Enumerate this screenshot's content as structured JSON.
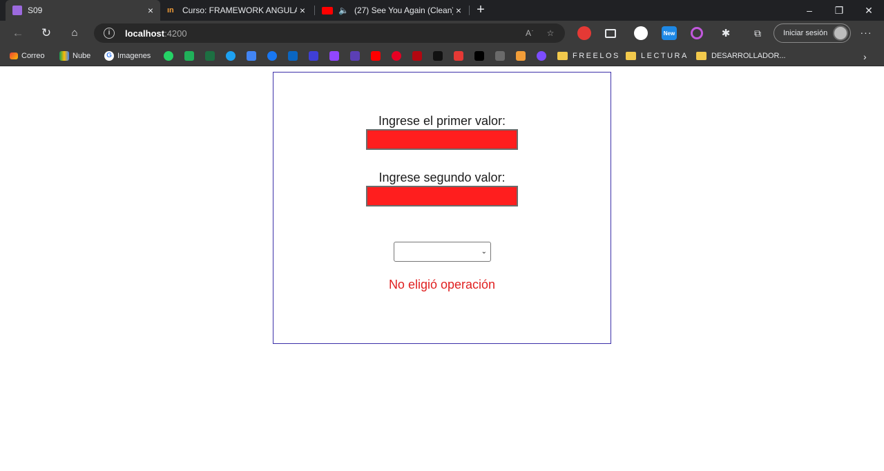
{
  "browser": {
    "tabs": [
      {
        "title": "S09",
        "icon": "grid-icon"
      },
      {
        "title": "Curso: FRAMEWORK ANGULAR (",
        "icon": "in-logo-icon"
      },
      {
        "title": "(27) See You Again (Clean) -",
        "icon": "youtube-icon"
      }
    ],
    "new_tab_label": "+",
    "close_glyph": "×",
    "window": {
      "minimize": "–",
      "restore": "❐",
      "close": "✕"
    }
  },
  "toolbar": {
    "url_host": "localhost",
    "url_port": ":4200",
    "signin_label": "Iniciar sesión",
    "badge_new": "New"
  },
  "bookmarks": {
    "correo": "Correo",
    "nube": "Nube",
    "imagenes": "Imagenes",
    "freelos": "FREELOS",
    "lectura": "LECTURA",
    "desarrollador": "DESARROLLADOR..."
  },
  "page": {
    "label1": "Ingrese el primer valor:",
    "label2": "Ingrese segundo valor:",
    "select_value": "",
    "message": "No eligió operación",
    "colors": {
      "field_bg": "#ff1e1e",
      "message": "#e02020",
      "panel_border": "#3b2fa8"
    }
  }
}
